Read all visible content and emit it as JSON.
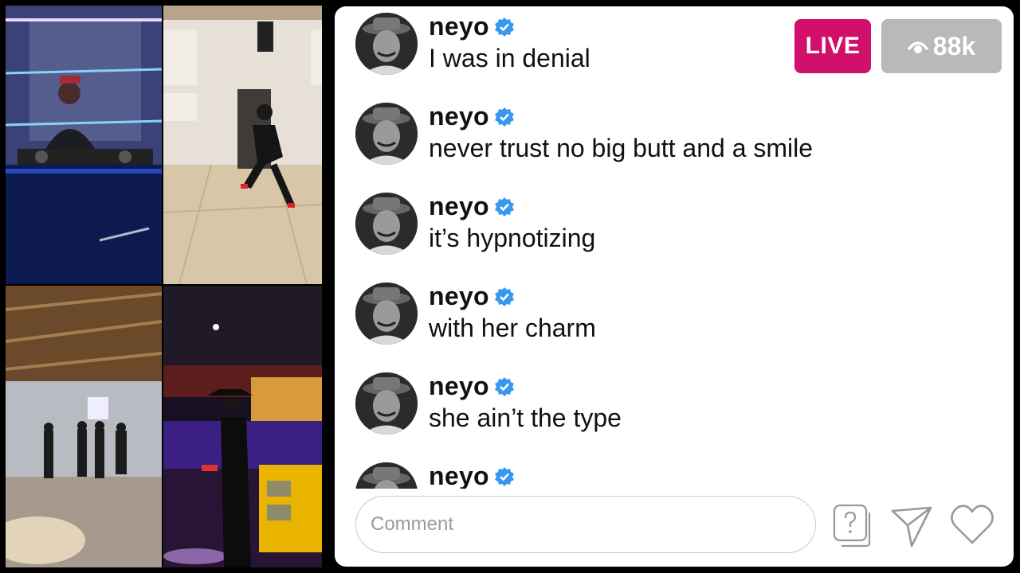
{
  "live": {
    "badge": "LIVE",
    "viewers": "88k",
    "badge_color": "#d1106c"
  },
  "comments": [
    {
      "username": "neyo",
      "text": "I was in denial"
    },
    {
      "username": "neyo",
      "text": "never trust no big butt and a smile"
    },
    {
      "username": "neyo",
      "text": "it’s hypnotizing"
    },
    {
      "username": "neyo",
      "text": "with her charm"
    },
    {
      "username": "neyo",
      "text": "she ain’t the type"
    },
    {
      "username": "neyo",
      "text": ""
    }
  ],
  "composer": {
    "placeholder": "Comment"
  },
  "icons": {
    "viewer": "eye-icon",
    "verified": "verified-badge-icon",
    "question": "question-box-icon",
    "send": "send-icon",
    "like": "heart-icon"
  },
  "colors": {
    "verified": "#3897f0",
    "viewer_badge": "#b9b9b9"
  }
}
